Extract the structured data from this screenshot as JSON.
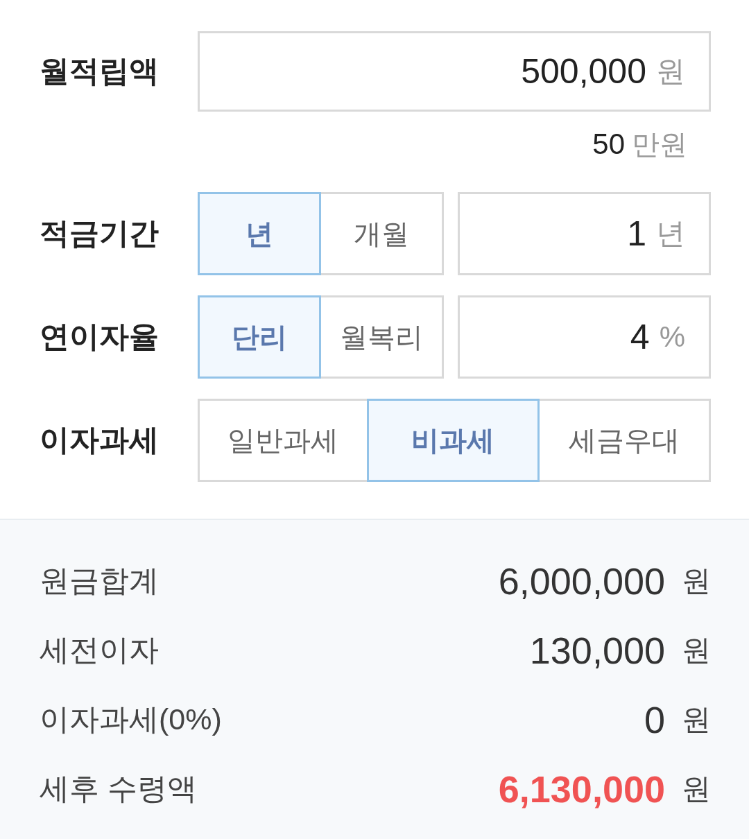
{
  "inputs": [
    {
      "kind": "field",
      "label": "월적립액",
      "value": "500,000",
      "unit": "원",
      "note": {
        "value": "50",
        "unit": "만원"
      }
    },
    {
      "kind": "segmented_field",
      "label": "적금기간",
      "options": [
        {
          "label": "년",
          "selected": true
        },
        {
          "label": "개월",
          "selected": false
        }
      ],
      "value": "1",
      "unit": "년"
    },
    {
      "kind": "segmented_field",
      "label": "연이자율",
      "options": [
        {
          "label": "단리",
          "selected": true
        },
        {
          "label": "월복리",
          "selected": false
        }
      ],
      "value": "4",
      "unit": "%"
    },
    {
      "kind": "segmented",
      "label": "이자과세",
      "options": [
        {
          "label": "일반과세",
          "selected": false
        },
        {
          "label": "비과세",
          "selected": true
        },
        {
          "label": "세금우대",
          "selected": false
        }
      ]
    }
  ],
  "results": [
    {
      "label": "원금합계",
      "value": "6,000,000",
      "unit": "원",
      "highlight": false
    },
    {
      "label": "세전이자",
      "value": "130,000",
      "unit": "원",
      "highlight": false
    },
    {
      "label": "이자과세(0%)",
      "value": "0",
      "unit": "원",
      "highlight": false
    },
    {
      "label": "세후 수령액",
      "value": "6,130,000",
      "unit": "원",
      "highlight": true
    }
  ]
}
